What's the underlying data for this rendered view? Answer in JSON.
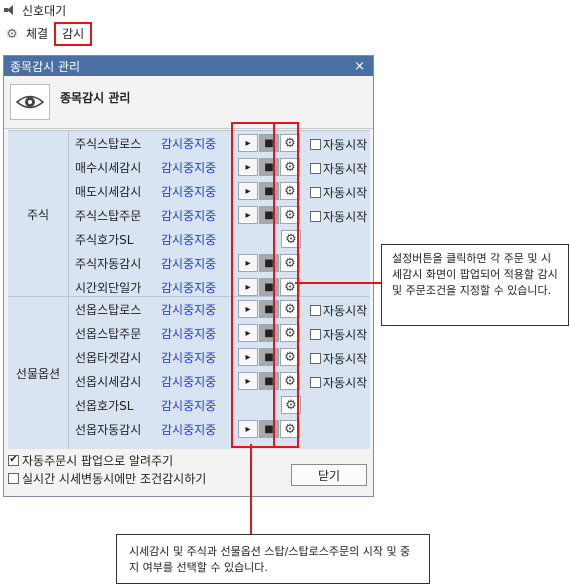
{
  "top": {
    "signal_label": "신호대기",
    "tabs": [
      "체결",
      "감시"
    ],
    "active_tab_index": 1
  },
  "window": {
    "title": "종목감시 관리",
    "close_glyph": "×",
    "header_title": "종목감시 관리"
  },
  "stock_group": {
    "label": "주식",
    "rows": [
      {
        "name": "주식스탑로스",
        "status": "감시중지중",
        "has_play": true,
        "auto": "자동시작"
      },
      {
        "name": "매수시세감시",
        "status": "감시중지중",
        "has_play": true,
        "auto": "자동시작"
      },
      {
        "name": "매도시세감시",
        "status": "감시중지중",
        "has_play": true,
        "auto": "자동시작"
      },
      {
        "name": "주식스탑주문",
        "status": "감시중지중",
        "has_play": true,
        "auto": "자동시작"
      },
      {
        "name": "주식호가SL",
        "status": "감시중지중",
        "has_play": false,
        "auto": ""
      },
      {
        "name": "주식자동감시",
        "status": "감시중지중",
        "has_play": true,
        "auto": ""
      },
      {
        "name": "시간외단일가",
        "status": "감시중지중",
        "has_play": true,
        "auto": ""
      }
    ]
  },
  "futures_group": {
    "label": "선물옵션",
    "rows": [
      {
        "name": "선옵스탑로스",
        "status": "감시중지중",
        "has_play": true,
        "auto": "자동시작"
      },
      {
        "name": "선옵스탑주문",
        "status": "감시중지중",
        "has_play": true,
        "auto": "자동시작"
      },
      {
        "name": "선옵타겟감시",
        "status": "감시중지중",
        "has_play": true,
        "auto": "자동시작"
      },
      {
        "name": "선옵시세감시",
        "status": "감시중지중",
        "has_play": true,
        "auto": "자동시작"
      },
      {
        "name": "선옵호가SL",
        "status": "감시중지중",
        "has_play": false,
        "auto": ""
      },
      {
        "name": "선옵자동감시",
        "status": "감시중지중",
        "has_play": true,
        "auto": ""
      }
    ]
  },
  "options": {
    "popup_notify": {
      "label": "자동주문시 팝업으로 알려주기",
      "checked": true
    },
    "realtime_only": {
      "label": "실시간 시세변동시에만 조건감시하기",
      "checked": false
    },
    "close_label": "닫기"
  },
  "callouts": {
    "settings_note": "설정버튼을 클릭하면 각 주문 및 시세감시 화면이 팝업되어 적용할 감시 및 주문조건을 지정할 수 있습니다.",
    "start_stop_note": "시세감시 및 주식과 선물옵션 스탑/스탑로스주문의 시작 및 중지 여부를 선택할 수 있습니다."
  },
  "icons": {
    "play": "▸",
    "stop": "■",
    "gear": "⚙",
    "check": "✔"
  },
  "colors": {
    "status_blue": "#1e44c7",
    "highlight_red": "#e0161e",
    "titlebar": "#4a6fa5",
    "panel": "#d9e4f2"
  }
}
